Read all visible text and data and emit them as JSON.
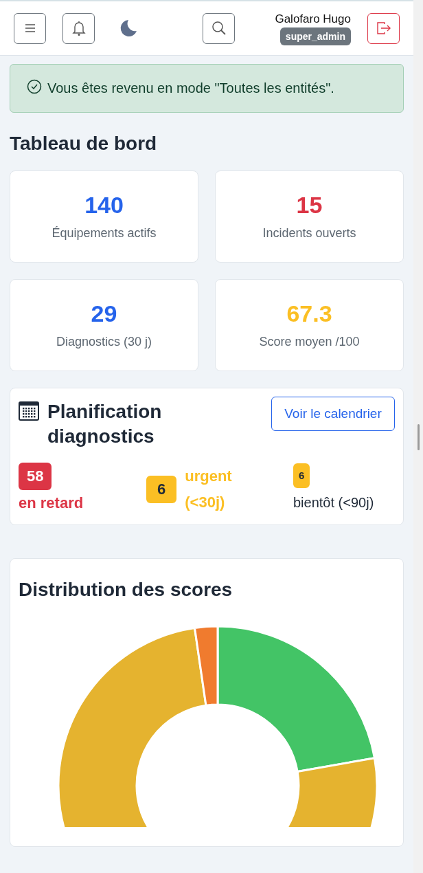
{
  "header": {
    "user_name": "Galofaro Hugo",
    "role": "super_admin"
  },
  "alert": {
    "message": "Vous êtes revenu en mode \"Toutes les entités\"."
  },
  "page_title": "Tableau de bord",
  "stats": [
    {
      "value": "140",
      "label": "Équipements actifs",
      "color": "#2563eb"
    },
    {
      "value": "15",
      "label": "Incidents ouverts",
      "color": "#dc3545"
    },
    {
      "value": "29",
      "label": "Diagnostics (30 j)",
      "color": "#2563eb"
    },
    {
      "value": "67.3",
      "label": "Score moyen /100",
      "color": "#fbbf24"
    }
  ],
  "planning": {
    "title": "Planification diagnostics",
    "button": "Voir le calendrier",
    "items": [
      {
        "kind": "overdue",
        "count": "58",
        "label": "en retard"
      },
      {
        "kind": "urgent",
        "count": "6",
        "label": "urgent (<30j)"
      },
      {
        "kind": "soon",
        "count": "6",
        "label": "bientôt (<90j)"
      }
    ]
  },
  "chart_card": {
    "title": "Distribution des scores"
  }
}
